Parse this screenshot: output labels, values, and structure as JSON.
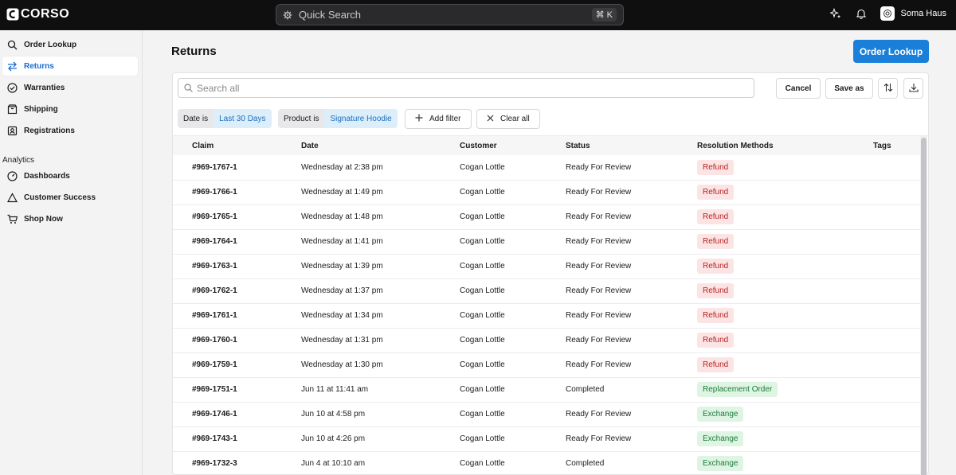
{
  "app": {
    "logo_text": "CORSO",
    "search_placeholder": "Quick Search",
    "search_shortcut": "⌘ K",
    "user_name": "Soma Haus"
  },
  "sidebar": {
    "items": [
      {
        "label": "Order Lookup",
        "icon": "search-icon",
        "active": false
      },
      {
        "label": "Returns",
        "icon": "arrows-swap-icon",
        "active": true
      },
      {
        "label": "Warranties",
        "icon": "check-circle-icon",
        "active": false
      },
      {
        "label": "Shipping",
        "icon": "box-icon",
        "active": false
      },
      {
        "label": "Registrations",
        "icon": "registration-icon",
        "active": false
      }
    ],
    "analytics_label": "Analytics",
    "analytics_items": [
      {
        "label": "Dashboards",
        "icon": "gauge-icon"
      },
      {
        "label": "Customer Success",
        "icon": "triangle-icon"
      },
      {
        "label": "Shop Now",
        "icon": "cart-icon"
      }
    ]
  },
  "main": {
    "title": "Returns",
    "primary_button": "Order Lookup",
    "search_placeholder": "Search all",
    "cancel_label": "Cancel",
    "save_as_label": "Save as",
    "filters": [
      {
        "key": "Date is",
        "value": "Last 30 Days"
      },
      {
        "key": "Product is",
        "value": "Signature Hoodie"
      }
    ],
    "add_filter_label": "Add filter",
    "clear_all_label": "Clear all",
    "table": {
      "columns": [
        "Claim",
        "Date",
        "Customer",
        "Status",
        "Resolution Methods",
        "Tags"
      ],
      "rows": [
        {
          "claim": "#969-1767-1",
          "date": "Wednesday at 2:38 pm",
          "customer": "Cogan Lottle",
          "status": "Ready For Review",
          "resolution": "Refund",
          "kind": "refund"
        },
        {
          "claim": "#969-1766-1",
          "date": "Wednesday at 1:49 pm",
          "customer": "Cogan Lottle",
          "status": "Ready For Review",
          "resolution": "Refund",
          "kind": "refund"
        },
        {
          "claim": "#969-1765-1",
          "date": "Wednesday at 1:48 pm",
          "customer": "Cogan Lottle",
          "status": "Ready For Review",
          "resolution": "Refund",
          "kind": "refund"
        },
        {
          "claim": "#969-1764-1",
          "date": "Wednesday at 1:41 pm",
          "customer": "Cogan Lottle",
          "status": "Ready For Review",
          "resolution": "Refund",
          "kind": "refund"
        },
        {
          "claim": "#969-1763-1",
          "date": "Wednesday at 1:39 pm",
          "customer": "Cogan Lottle",
          "status": "Ready For Review",
          "resolution": "Refund",
          "kind": "refund"
        },
        {
          "claim": "#969-1762-1",
          "date": "Wednesday at 1:37 pm",
          "customer": "Cogan Lottle",
          "status": "Ready For Review",
          "resolution": "Refund",
          "kind": "refund"
        },
        {
          "claim": "#969-1761-1",
          "date": "Wednesday at 1:34 pm",
          "customer": "Cogan Lottle",
          "status": "Ready For Review",
          "resolution": "Refund",
          "kind": "refund"
        },
        {
          "claim": "#969-1760-1",
          "date": "Wednesday at 1:31 pm",
          "customer": "Cogan Lottle",
          "status": "Ready For Review",
          "resolution": "Refund",
          "kind": "refund"
        },
        {
          "claim": "#969-1759-1",
          "date": "Wednesday at 1:30 pm",
          "customer": "Cogan Lottle",
          "status": "Ready For Review",
          "resolution": "Refund",
          "kind": "refund"
        },
        {
          "claim": "#969-1751-1",
          "date": "Jun 11 at 11:41 am",
          "customer": "Cogan Lottle",
          "status": "Completed",
          "resolution": "Replacement Order",
          "kind": "replacement"
        },
        {
          "claim": "#969-1746-1",
          "date": "Jun 10 at 4:58 pm",
          "customer": "Cogan Lottle",
          "status": "Ready For Review",
          "resolution": "Exchange",
          "kind": "exchange"
        },
        {
          "claim": "#969-1743-1",
          "date": "Jun 10 at 4:26 pm",
          "customer": "Cogan Lottle",
          "status": "Ready For Review",
          "resolution": "Exchange",
          "kind": "exchange"
        },
        {
          "claim": "#969-1732-3",
          "date": "Jun 4 at 10:10 am",
          "customer": "Cogan Lottle",
          "status": "Completed",
          "resolution": "Exchange",
          "kind": "exchange"
        }
      ]
    }
  },
  "colors": {
    "accent": "#1a7fd9",
    "topbar": "#0f0f10",
    "refund_bg": "#fde4e4",
    "success_bg": "#dff5e4"
  }
}
